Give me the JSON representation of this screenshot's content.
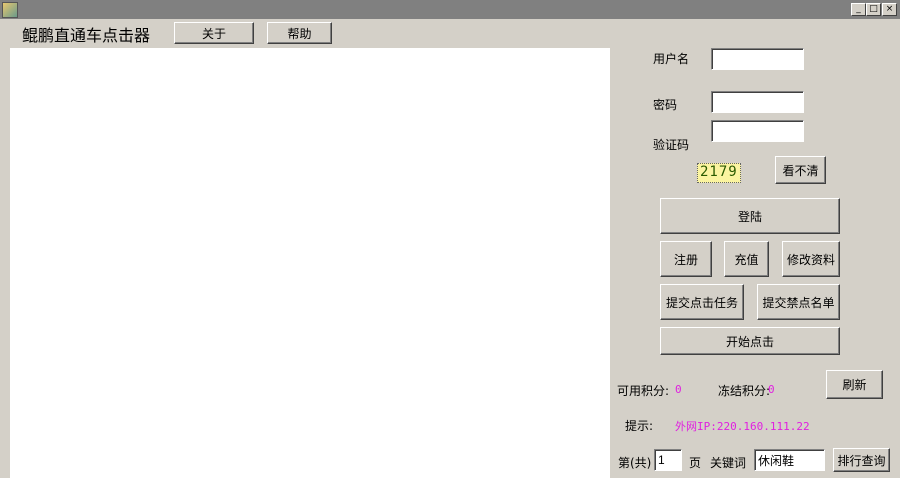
{
  "app": {
    "title": "鲲鹏直通车点击器",
    "about": "关于",
    "help": "帮助"
  },
  "window": {
    "minimize": "_",
    "maximize": "□",
    "close": "×"
  },
  "login": {
    "username_label": "用户名",
    "username_value": "",
    "password_label": "密码",
    "password_value": "",
    "captcha_label": "验证码",
    "captcha_value": "",
    "captcha_text": "2179",
    "refresh_captcha": "看不清",
    "login": "登陆"
  },
  "actions": {
    "register": "注册",
    "recharge": "充值",
    "edit_profile": "修改资料",
    "submit_task": "提交点击任务",
    "submit_blacklist": "提交禁点名单",
    "start_click": "开始点击"
  },
  "points": {
    "available_label": "可用积分:",
    "available_value": "0",
    "frozen_label": "冻结积分:",
    "frozen_value": "0",
    "refresh": "刷新"
  },
  "hint": {
    "label": "提示:",
    "text": "外网IP:220.160.111.22"
  },
  "ranking": {
    "page_prefix": "第(共)",
    "page_value": "1",
    "page_suffix": "页",
    "keyword_label": "关键词",
    "keyword_value": "休闲鞋",
    "query": "排行查询"
  }
}
